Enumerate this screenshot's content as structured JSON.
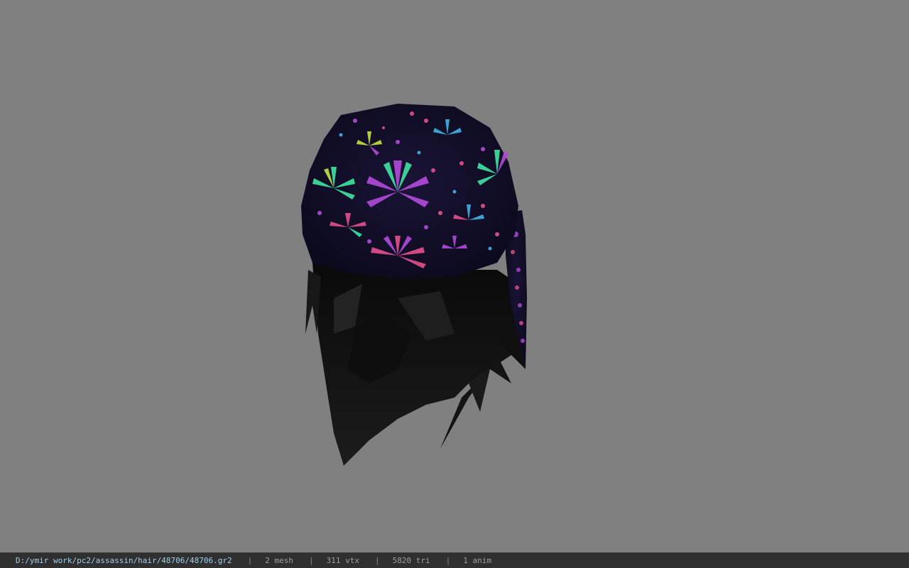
{
  "viewer": {
    "background_color": "#808080",
    "model": {
      "icon": "bandana-hair-model",
      "bandana_base_color": "#14102e",
      "hair_color": "#141414",
      "pattern_colors": [
        "#b04ad8",
        "#3fe0a0",
        "#e0508a",
        "#40b0e0",
        "#c0e040"
      ]
    }
  },
  "status": {
    "file_path": "D:/ymir work/pc2/assassin/hair/48706/48706.gr2",
    "separator": "|",
    "mesh": "2 mesh",
    "vertices": "311 vtx",
    "triangles": "5820 tri",
    "animations": "1 anim"
  }
}
